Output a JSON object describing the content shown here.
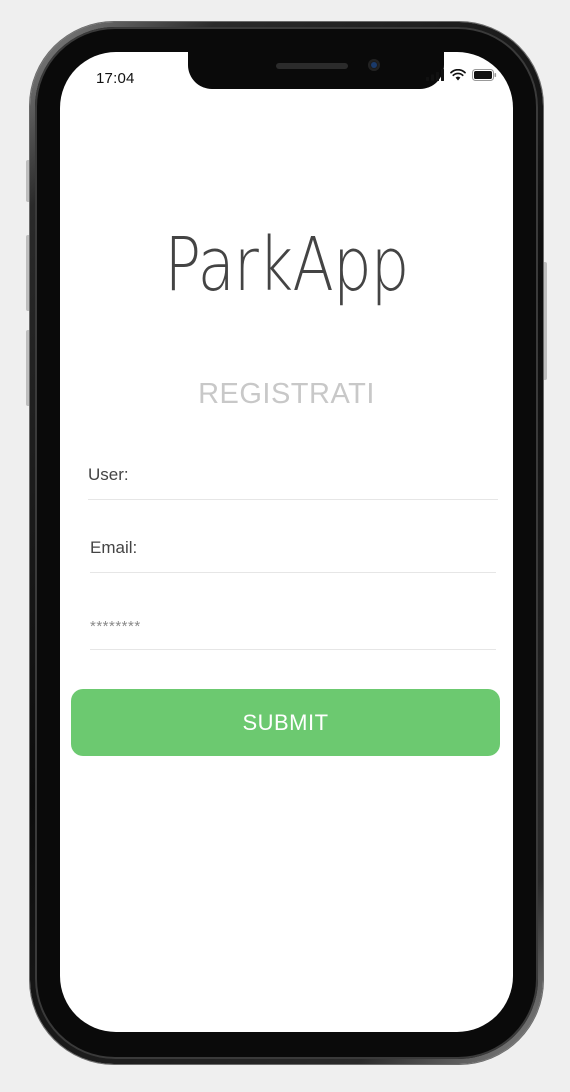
{
  "status_bar": {
    "time": "17:04",
    "icons": [
      "signal-icon",
      "wifi-icon",
      "battery-icon"
    ]
  },
  "app": {
    "title": "ParkApp",
    "subtitle": "REGISTRATI"
  },
  "form": {
    "user_placeholder": "User:",
    "email_placeholder": "Email:",
    "password_placeholder": "********",
    "submit_label": "SUBMIT"
  },
  "colors": {
    "accent": "#6cc970",
    "background": "#ffffff",
    "logo_text": "#444444",
    "subtitle_text": "#c8c8c8"
  }
}
